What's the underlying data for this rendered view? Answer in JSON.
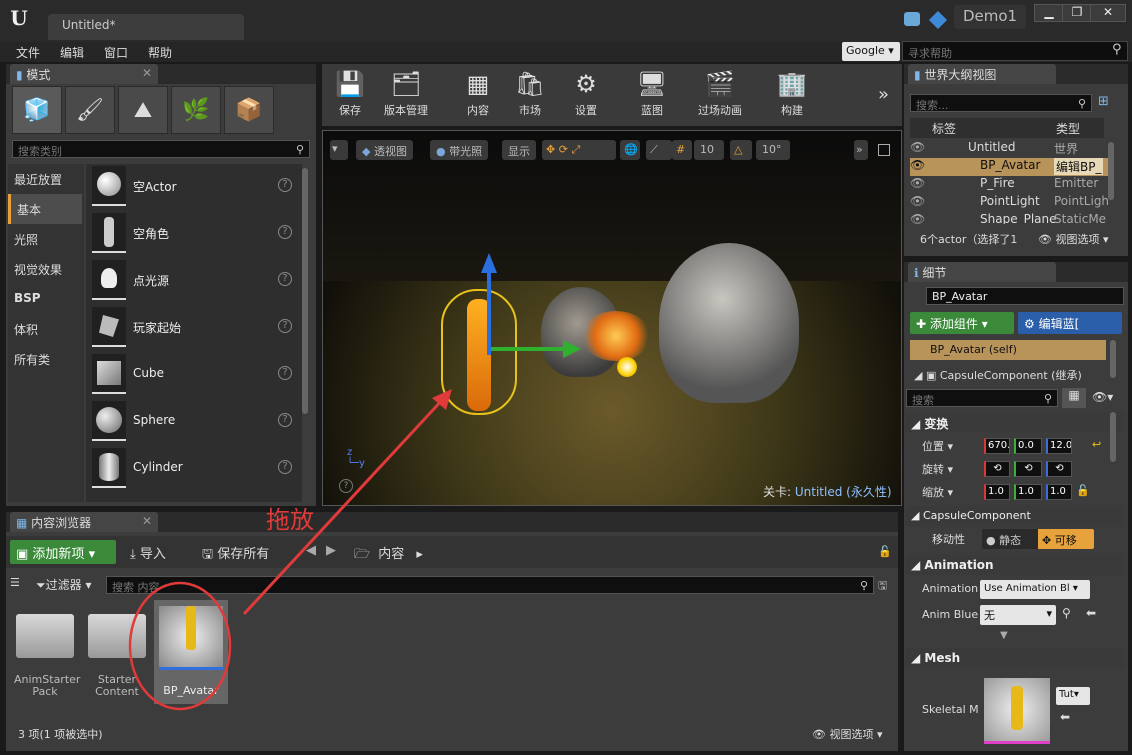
{
  "window": {
    "tab_title": "Untitled*",
    "project": "Demo1",
    "controls": [
      "▁",
      "❐",
      "✕"
    ]
  },
  "menu": [
    "文件",
    "编辑",
    "窗口",
    "帮助"
  ],
  "help": {
    "engine": "Google",
    "search_placeholder": "寻求帮助"
  },
  "modes": {
    "tab": "模式",
    "search_placeholder": "搜索类别",
    "categories": [
      "最近放置",
      "基本",
      "光照",
      "视觉效果",
      "BSP",
      "体积",
      "所有类"
    ],
    "items": [
      "空Actor",
      "空角色",
      "点光源",
      "玩家起始",
      "Cube",
      "Sphere",
      "Cylinder"
    ]
  },
  "toolbar": {
    "buttons": [
      "保存",
      "版本管理",
      "内容",
      "市场",
      "设置",
      "蓝图",
      "过场动画",
      "构建"
    ]
  },
  "viewport": {
    "perspective": "透视图",
    "lit": "带光照",
    "show": "显示",
    "grid_snap": "10",
    "rot_snap": "10°",
    "level_label": "关卡:",
    "level_name": "Untitled (永久性)"
  },
  "annotation": {
    "text": "拖放",
    "color": "#e03a3a"
  },
  "outliner": {
    "tab": "世界大纲视图",
    "search_placeholder": "搜索...",
    "col_label": "标签",
    "col_type": "类型",
    "rows": [
      {
        "name": "Untitled",
        "type": "世界"
      },
      {
        "name": "BP_Avatar",
        "type": "编辑BP_"
      },
      {
        "name": "P_Fire",
        "type": "Emitter"
      },
      {
        "name": "PointLight",
        "type": "PointLigh"
      },
      {
        "name": "Shape_Plane",
        "type": "StaticMe"
      }
    ],
    "status": "6个actor（选择了1",
    "view_options": "视图选项"
  },
  "details": {
    "tab": "细节",
    "name": "BP_Avatar",
    "add_component": "添加组件",
    "edit_blueprint": "编辑蓝[",
    "components": [
      "BP_Avatar (self)",
      "CapsuleComponent (继承)"
    ],
    "search_placeholder": "搜索",
    "transform_header": "变换",
    "location_label": "位置",
    "rotation_label": "旋转",
    "scale_label": "缩放",
    "location": [
      "670.",
      "0.0 c",
      "12.0"
    ],
    "scale": [
      "1.0",
      "1.0",
      "1.0"
    ],
    "capsule_header": "CapsuleComponent",
    "mobility_label": "移动性",
    "static_label": "静态",
    "movable_label": "可移",
    "animation_header": "Animation",
    "animation_label": "Animation",
    "animation_value": "Use Animation Bl",
    "anim_blue_label": "Anim Blue",
    "anim_blue_value": "无",
    "mesh_header": "Mesh",
    "skeletal_label": "Skeletal M",
    "mesh_combo": "Tut"
  },
  "content": {
    "tab": "内容浏览器",
    "add_new": "添加新项",
    "import": "导入",
    "save_all": "保存所有",
    "path": "内容",
    "filters": "过滤器",
    "search_placeholder": "搜索 内容",
    "items": [
      "AnimStarter Pack",
      "Starter Content",
      "BP_Avatar"
    ],
    "status": "3 项(1 项被选中)",
    "view_options": "视图选项"
  }
}
